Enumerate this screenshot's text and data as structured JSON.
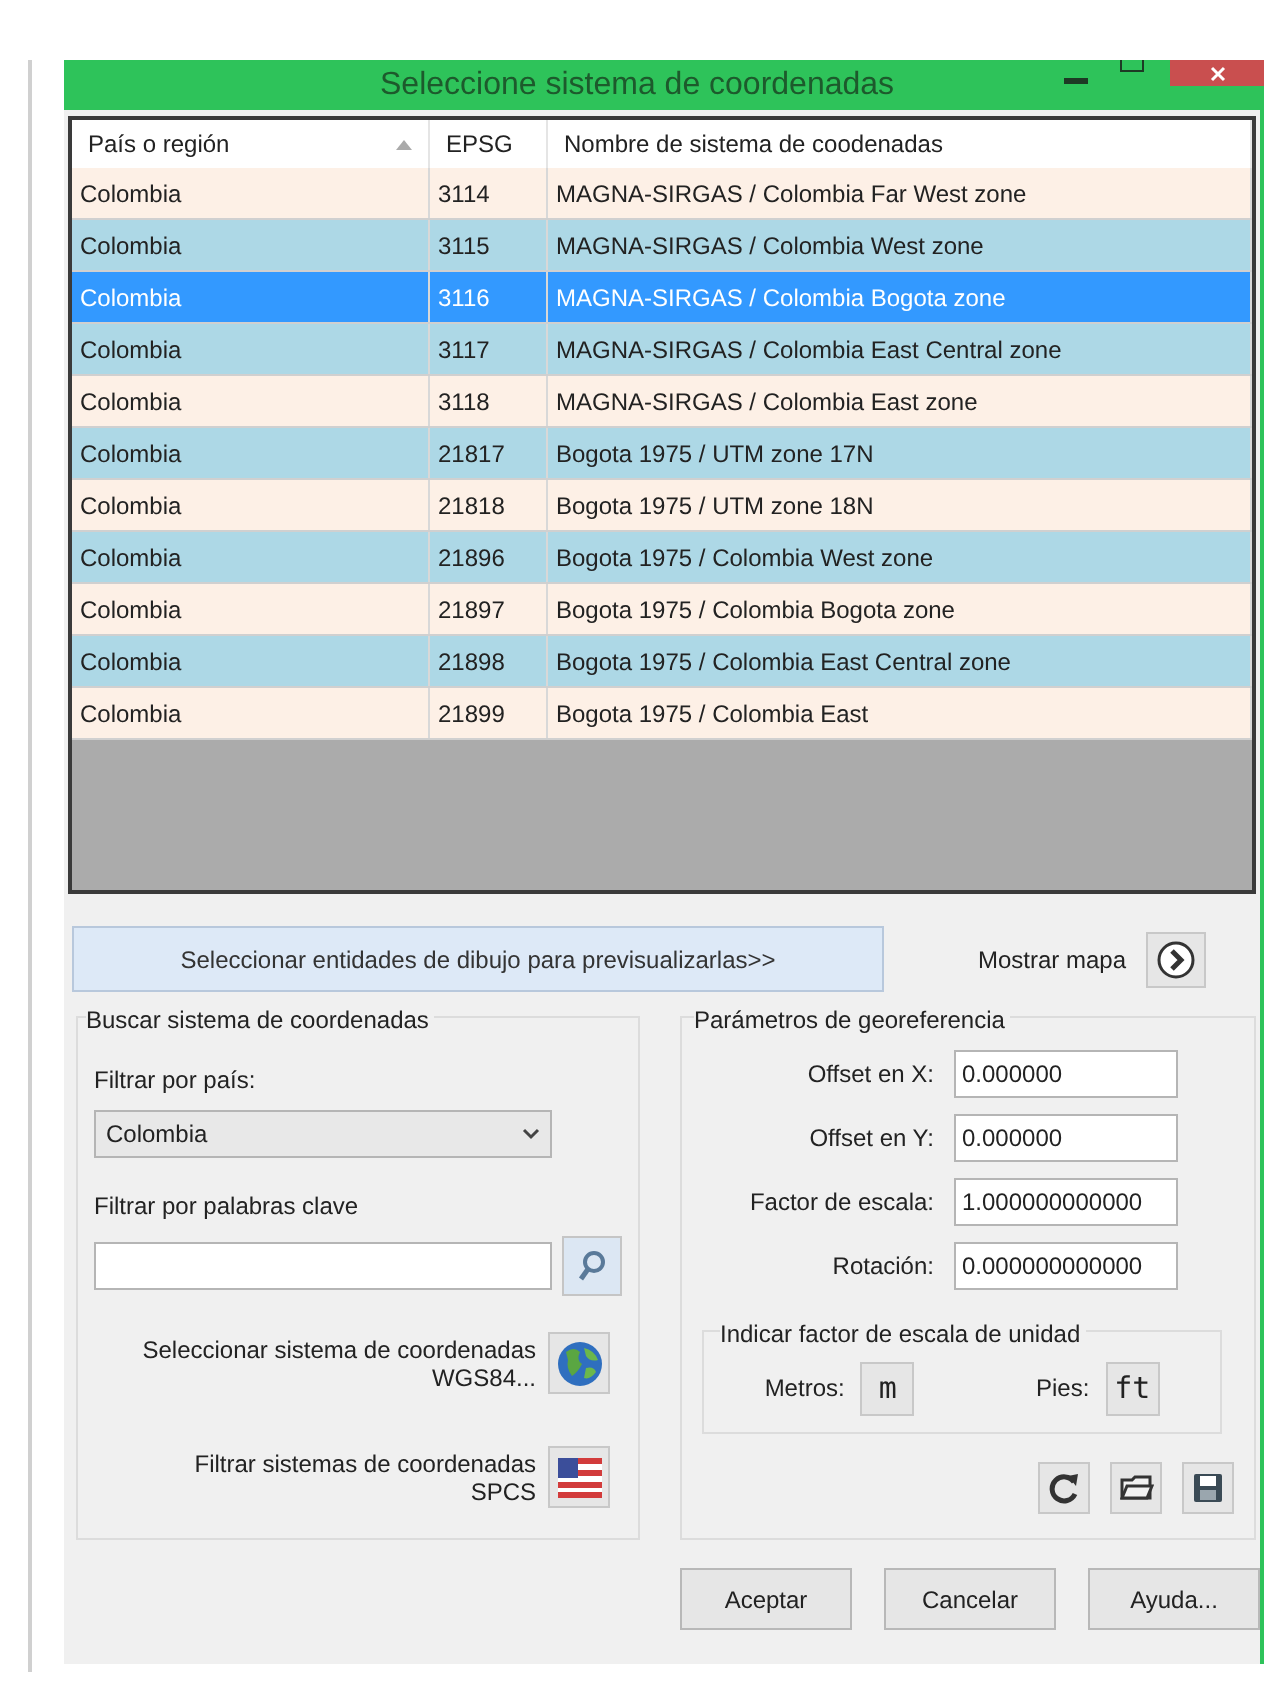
{
  "window": {
    "title": "Seleccione sistema de coordenadas"
  },
  "table": {
    "columns": [
      {
        "label": "País o región",
        "sorted": true
      },
      {
        "label": "EPSG",
        "sorted": false
      },
      {
        "label": "Nombre de sistema de coodenadas",
        "sorted": false
      }
    ],
    "rows": [
      {
        "cells": [
          "Colombia",
          "3114",
          "MAGNA-SIRGAS / Colombia Far West zone"
        ],
        "selected": false
      },
      {
        "cells": [
          "Colombia",
          "3115",
          "MAGNA-SIRGAS / Colombia West zone"
        ],
        "selected": false
      },
      {
        "cells": [
          "Colombia",
          "3116",
          "MAGNA-SIRGAS / Colombia Bogota zone"
        ],
        "selected": true
      },
      {
        "cells": [
          "Colombia",
          "3117",
          "MAGNA-SIRGAS / Colombia East Central zone"
        ],
        "selected": false
      },
      {
        "cells": [
          "Colombia",
          "3118",
          "MAGNA-SIRGAS / Colombia East zone"
        ],
        "selected": false
      },
      {
        "cells": [
          "Colombia",
          "21817",
          "Bogota 1975 / UTM zone 17N"
        ],
        "selected": false
      },
      {
        "cells": [
          "Colombia",
          "21818",
          "Bogota 1975 / UTM zone 18N"
        ],
        "selected": false
      },
      {
        "cells": [
          "Colombia",
          "21896",
          "Bogota 1975 / Colombia West zone"
        ],
        "selected": false
      },
      {
        "cells": [
          "Colombia",
          "21897",
          "Bogota 1975 / Colombia Bogota zone"
        ],
        "selected": false
      },
      {
        "cells": [
          "Colombia",
          "21898",
          "Bogota 1975 / Colombia East Central zone"
        ],
        "selected": false
      },
      {
        "cells": [
          "Colombia",
          "21899",
          "Bogota 1975 / Colombia East"
        ],
        "selected": false
      }
    ]
  },
  "preview_button": "Seleccionar entidades de dibujo para previsualizarlas>>",
  "show_map": {
    "label": "Mostrar mapa"
  },
  "search": {
    "title": "Buscar sistema de coordenadas",
    "country_filter": {
      "label": "Filtrar por país:",
      "value": "Colombia"
    },
    "keyword_filter": {
      "label": "Filtrar por palabras clave"
    },
    "wgs84": {
      "lines": [
        "Seleccionar sistema de coordenadas",
        "WGS84..."
      ]
    },
    "spcs": {
      "lines": [
        "Filtrar sistemas de coordenadas",
        "SPCS"
      ]
    }
  },
  "georeference": {
    "title": "Parámetros de georeferencia",
    "fields": [
      {
        "label": "Offset en X:",
        "value": "0.000000"
      },
      {
        "label": "Offset en Y:",
        "value": "0.000000"
      },
      {
        "label": "Factor de escala:",
        "value": "1.000000000000"
      },
      {
        "label": "Rotación:",
        "value": "0.000000000000"
      }
    ],
    "unit_scale": {
      "title": "Indicar factor de escala de unidad",
      "units": [
        {
          "label": "Metros:",
          "button": "m"
        },
        {
          "label": "Pies:",
          "button": "ft"
        }
      ]
    }
  },
  "buttons": [
    "Aceptar",
    "Cancelar",
    "Ayuda..."
  ]
}
